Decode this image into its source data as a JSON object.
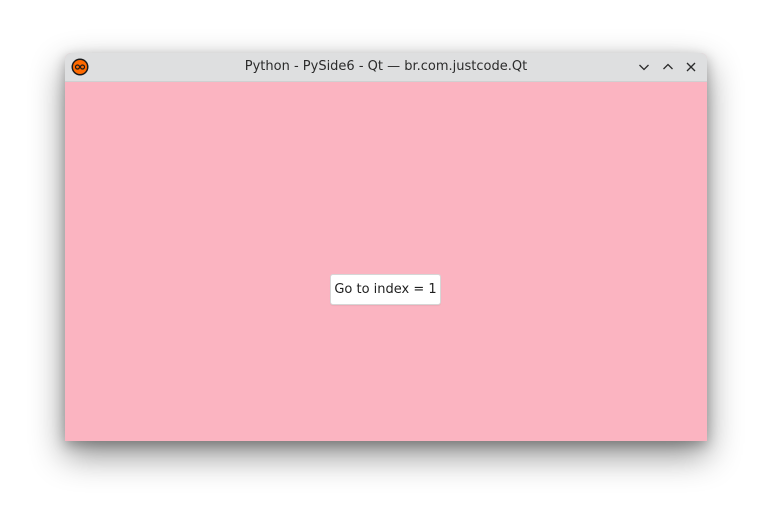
{
  "window": {
    "title": "Python - PySide6 - Qt — br.com.justcode.Qt",
    "background_color": "#fbb4c1",
    "titlebar_color": "#dedfe0"
  },
  "titlebar": {
    "icons": {
      "app": "app-logo-icon",
      "minimize": "chevron-down-icon",
      "maximize": "chevron-up-icon",
      "close": "close-icon"
    }
  },
  "content": {
    "button_label": "Go to index = 1"
  }
}
